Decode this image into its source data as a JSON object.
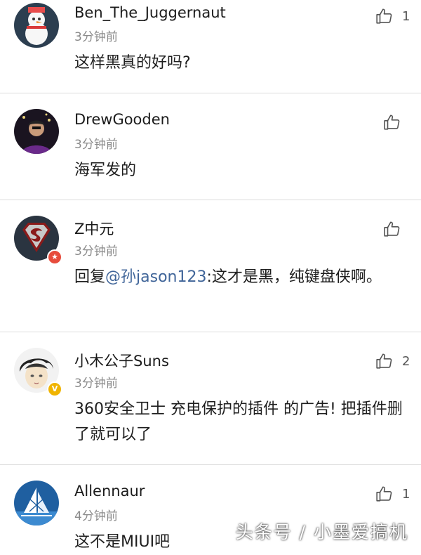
{
  "comments": [
    {
      "username": "Ben_The_Juggernaut",
      "time": "3分钟前",
      "text": "这样黑真的好吗?",
      "likes": "1",
      "avatar_icon": "snowman-avatar-icon"
    },
    {
      "username": "DrewGooden",
      "time": "3分钟前",
      "text": "海军发的",
      "likes": "",
      "avatar_icon": "person-avatar-icon"
    },
    {
      "username": "Z中元",
      "time": "3分钟前",
      "reply_prefix": "回复",
      "mention": "@孙jason123",
      "text": ":这才是黑，纯键盘侠啊。",
      "likes": "",
      "avatar_icon": "superman-logo-avatar-icon",
      "badge_icon": "star-badge-icon",
      "badge_color": "#e74c3c"
    },
    {
      "username": "小木公子Suns",
      "time": "3分钟前",
      "text": "360安全卫士 充电保护的插件 的广告! 把插件删了就可以了",
      "likes": "2",
      "avatar_icon": "anime-face-avatar-icon",
      "badge_icon": "verified-v-badge-icon",
      "badge_color": "#f0b400"
    },
    {
      "username": "Allennaur",
      "time": "4分钟前",
      "text": "这不是MIUI吧",
      "likes": "1",
      "avatar_icon": "sail-logo-avatar-icon"
    }
  ],
  "watermark": "头条号 / 小墨爱搞机",
  "colors": {
    "mention": "#406599",
    "divider": "#dcdcdc"
  }
}
